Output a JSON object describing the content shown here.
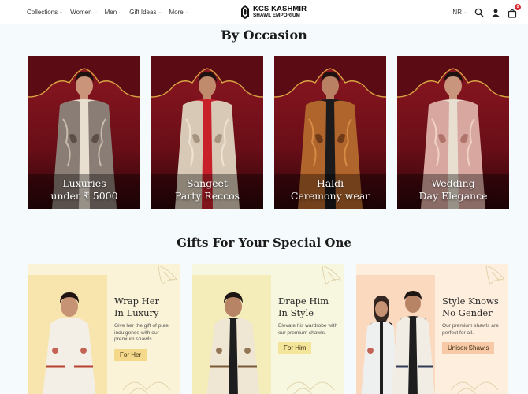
{
  "header": {
    "nav": [
      {
        "label": "Collections"
      },
      {
        "label": "Women"
      },
      {
        "label": "Men"
      },
      {
        "label": "Gift Ideas"
      },
      {
        "label": "More"
      }
    ],
    "logo_line1": "KCS KASHMIR",
    "logo_line2": "SHAWL EMPORIUM",
    "currency": "INR",
    "cart_count": "0"
  },
  "sections": {
    "occasion_title": "By Occasion",
    "gifts_title": "Gifts For Your Special One"
  },
  "occasions": [
    {
      "line1": "Luxuries",
      "line2": "under ₹ 5000"
    },
    {
      "line1": "Sangeet",
      "line2": "Party Reccos"
    },
    {
      "line1": "Haldi",
      "line2": "Ceremony wear"
    },
    {
      "line1": "Wedding",
      "line2": "Day Elegance"
    }
  ],
  "gifts": [
    {
      "heading1": "Wrap Her",
      "heading2": "In Luxury",
      "desc": "Give her the gift of pure indulgence with our premium shawls.",
      "button": "For Her",
      "bg": "#fbf3d8",
      "accent": "#f4d98a"
    },
    {
      "heading1": "Drape Him",
      "heading2": "In Style",
      "desc": "Elevate his wardrobe with our premium shawls.",
      "button": "For Him",
      "bg": "#f7f6de",
      "accent": "#f3e59a"
    },
    {
      "heading1": "Style Knows",
      "heading2": "No Gender",
      "desc": "Our premium shawls are perfect for all.",
      "button": "Unisex Shawls",
      "bg": "#fdeedd",
      "accent": "#f7c9a6"
    }
  ]
}
